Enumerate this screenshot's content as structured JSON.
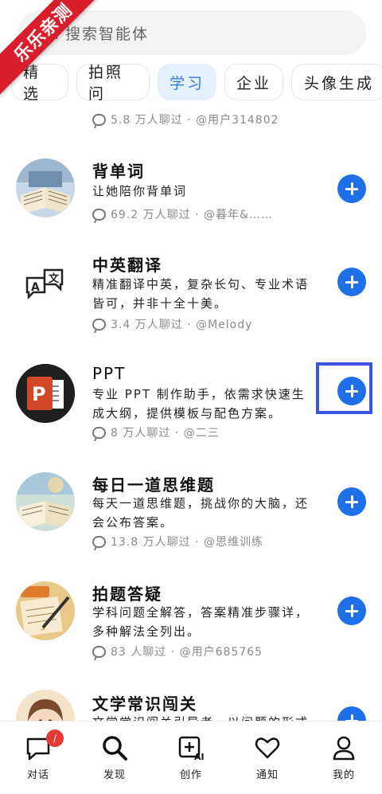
{
  "watermark": "乐乐亲测",
  "search": {
    "placeholder": "搜索智能体"
  },
  "tabs": [
    {
      "label": "精选",
      "active": false
    },
    {
      "label": "拍照问",
      "active": false
    },
    {
      "label": "学习",
      "active": true
    },
    {
      "label": "企业",
      "active": false
    },
    {
      "label": "头像生成",
      "active": false
    }
  ],
  "top_meta": "5.8 万人聊过 · @用户314802",
  "agents": [
    {
      "title": "背单词",
      "desc": "让她陪你背单词",
      "meta": "69.2 万人聊过 · @暮年&……",
      "avatar_icon": "open-book-icon"
    },
    {
      "title": "中英翻译",
      "desc": "精准翻译中英，复杂长句、专业术语皆可，并非十全十美。",
      "meta": "3.4 万人聊过 · @Melody",
      "avatar_icon": "translate-icon"
    },
    {
      "title": "PPT",
      "desc": "专业 PPT 制作助手，依需求快速生成大纲，提供模板与配色方案。",
      "meta": "8 万人聊过 · @二三",
      "avatar_icon": "powerpoint-icon"
    },
    {
      "title": "每日一道思维题",
      "desc": "每天一道思维题，挑战你的大脑，还会公布答案。",
      "meta": "13.8 万人聊过 · @思维训练",
      "avatar_icon": "study-book-icon"
    },
    {
      "title": "拍题答疑",
      "desc": "学科问题全解答，答案精准步骤详，多种解法全列出。",
      "meta": "83 人聊过 · @用户685765",
      "avatar_icon": "notebook-pen-icon"
    },
    {
      "title": "文学常识闯关",
      "desc": "文学常识闯关引导者，以问题的形式",
      "meta": "",
      "avatar_icon": "girl-avatar-icon"
    }
  ],
  "nav": [
    {
      "label": "对话",
      "icon": "chat-bubble-icon",
      "badge": "/"
    },
    {
      "label": "发现",
      "icon": "search-icon"
    },
    {
      "label": "创作",
      "icon": "create-ai-icon"
    },
    {
      "label": "通知",
      "icon": "heart-icon"
    },
    {
      "label": "我的",
      "icon": "profile-icon"
    }
  ],
  "colors": {
    "accent": "#1f6fe8",
    "active_tab_bg": "#e5f0fd",
    "active_tab_text": "#2f7ee8",
    "highlight_box": "#3c55e0",
    "ribbon": "#d81e2a"
  }
}
